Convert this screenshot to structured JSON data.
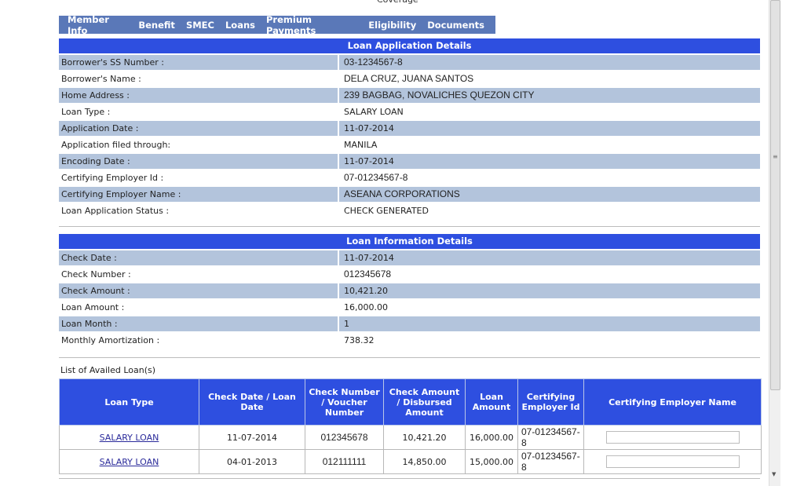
{
  "top_cut_text": "Coverage",
  "nav": [
    "Member Info",
    "Benefit",
    "SMEC",
    "Loans",
    "Premium Payments",
    "Eligibility",
    "Documents"
  ],
  "application": {
    "title": "Loan Application Details",
    "rows": [
      {
        "label": "Borrower's SS Number :",
        "value": "03-1234567-8"
      },
      {
        "label": "Borrower's Name :",
        "value": "DELA CRUZ, JUANA SANTOS"
      },
      {
        "label": "Home Address :",
        "value": "239 BAGBAG, NOVALICHES QUEZON CITY"
      },
      {
        "label": "Loan Type :",
        "value": "SALARY LOAN"
      },
      {
        "label": "Application Date :",
        "value": "11-07-2014"
      },
      {
        "label": "Application filed through:",
        "value": "MANILA"
      },
      {
        "label": "Encoding Date :",
        "value": "11-07-2014"
      },
      {
        "label": "Certifying Employer Id :",
        "value": "07-01234567-8"
      },
      {
        "label": "Certifying Employer Name :",
        "value": "ASEANA CORPORATIONS"
      },
      {
        "label": "Loan Application Status :",
        "value": "CHECK GENERATED"
      }
    ]
  },
  "information": {
    "title": "Loan Information Details",
    "rows": [
      {
        "label": "Check Date :",
        "value": "11-07-2014"
      },
      {
        "label": "Check Number :",
        "value": "012345678"
      },
      {
        "label": "Check Amount :",
        "value": "10,421.20"
      },
      {
        "label": "Loan Amount :",
        "value": "16,000.00"
      },
      {
        "label": "Loan Month :",
        "value": "1"
      },
      {
        "label": "Monthly Amortization :",
        "value": "738.32"
      }
    ]
  },
  "availed": {
    "title": "List of Availed Loan(s)",
    "headers": [
      "Loan Type",
      "Check Date / Loan Date",
      "Check Number / Voucher Number",
      "Check Amount / Disbursed Amount",
      "Loan Amount",
      "Certifying Employer Id",
      "Certifying Employer Name"
    ],
    "rows": [
      {
        "loan_type": "SALARY LOAN",
        "date": "11-07-2014",
        "check_number": "012345678",
        "check_amount": "10,421.20",
        "loan_amount": "16,000.00",
        "employer_id": "07-01234567-8",
        "employer_name": ""
      },
      {
        "loan_type": "SALARY LOAN",
        "date": "04-01-2013",
        "check_number": "012111111",
        "check_amount": "14,850.00",
        "loan_amount": "15,000.00",
        "employer_id": "07-01234567-8",
        "employer_name": ""
      }
    ]
  }
}
